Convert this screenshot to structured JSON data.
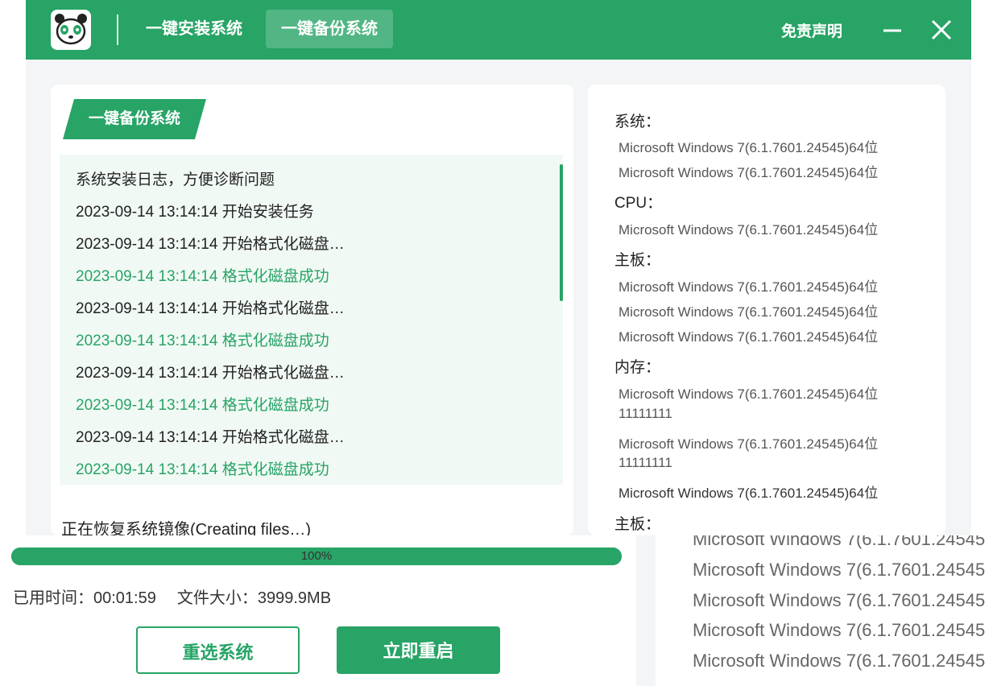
{
  "window": {
    "tabs": [
      {
        "label": "一键安装系统",
        "active": false
      },
      {
        "label": "一键备份系统",
        "active": true
      }
    ],
    "disclaimer": "免责声明",
    "accent_color": "#27a466",
    "icons": {
      "logo": "panda-logo-icon",
      "minimize": "minimize-icon",
      "close": "close-icon"
    }
  },
  "log_panel": {
    "badge": "一键备份系统",
    "header": "系统安装日志，方便诊断问题",
    "lines": [
      {
        "text": "2023-09-14 13:14:14 开始安装任务",
        "status": "normal"
      },
      {
        "text": "2023-09-14 13:14:14 开始格式化磁盘…",
        "status": "normal"
      },
      {
        "text": "2023-09-14 13:14:14 格式化磁盘成功",
        "status": "success"
      },
      {
        "text": "2023-09-14 13:14:14 开始格式化磁盘…",
        "status": "normal"
      },
      {
        "text": "2023-09-14 13:14:14 格式化磁盘成功",
        "status": "success"
      },
      {
        "text": "2023-09-14 13:14:14 开始格式化磁盘…",
        "status": "normal"
      },
      {
        "text": "2023-09-14 13:14:14 格式化磁盘成功",
        "status": "success"
      },
      {
        "text": "2023-09-14 13:14:14 开始格式化磁盘…",
        "status": "normal"
      },
      {
        "text": "2023-09-14 13:14:14 格式化磁盘成功",
        "status": "success"
      }
    ],
    "status_text": "正在恢复系统镜像(Creating files…)"
  },
  "info_panel": {
    "sections": [
      {
        "title": "系统：",
        "values": [
          "Microsoft Windows 7(6.1.7601.24545)64位",
          "Microsoft Windows 7(6.1.7601.24545)64位"
        ]
      },
      {
        "title": "CPU：",
        "values": [
          "Microsoft Windows 7(6.1.7601.24545)64位"
        ]
      },
      {
        "title": "主板：",
        "values": [
          "Microsoft Windows 7(6.1.7601.24545)64位",
          "Microsoft Windows 7(6.1.7601.24545)64位",
          "Microsoft Windows 7(6.1.7601.24545)64位"
        ]
      },
      {
        "title": "内存：",
        "values": [
          "Microsoft Windows 7(6.1.7601.24545)64位",
          "11111111",
          "Microsoft Windows 7(6.1.7601.24545)64位",
          "11111111",
          "Microsoft Windows 7(6.1.7601.24545)64位"
        ]
      },
      {
        "title": "主板：",
        "values": []
      }
    ]
  },
  "progress": {
    "percent": 100,
    "label": "100%",
    "elapsed_label": "已用时间：",
    "elapsed": "00:01:59",
    "size_label": "文件大小：",
    "size": "3999.9MB"
  },
  "buttons": {
    "reselect": "重选系统",
    "restart": "立即重启"
  },
  "overlay_list": [
    "Microsoft Windows 7(6.1.7601.24545",
    "Microsoft Windows 7(6.1.7601.24545",
    "Microsoft Windows 7(6.1.7601.24545",
    "Microsoft Windows 7(6.1.7601.24545",
    "Microsoft Windows 7(6.1.7601.24545"
  ]
}
